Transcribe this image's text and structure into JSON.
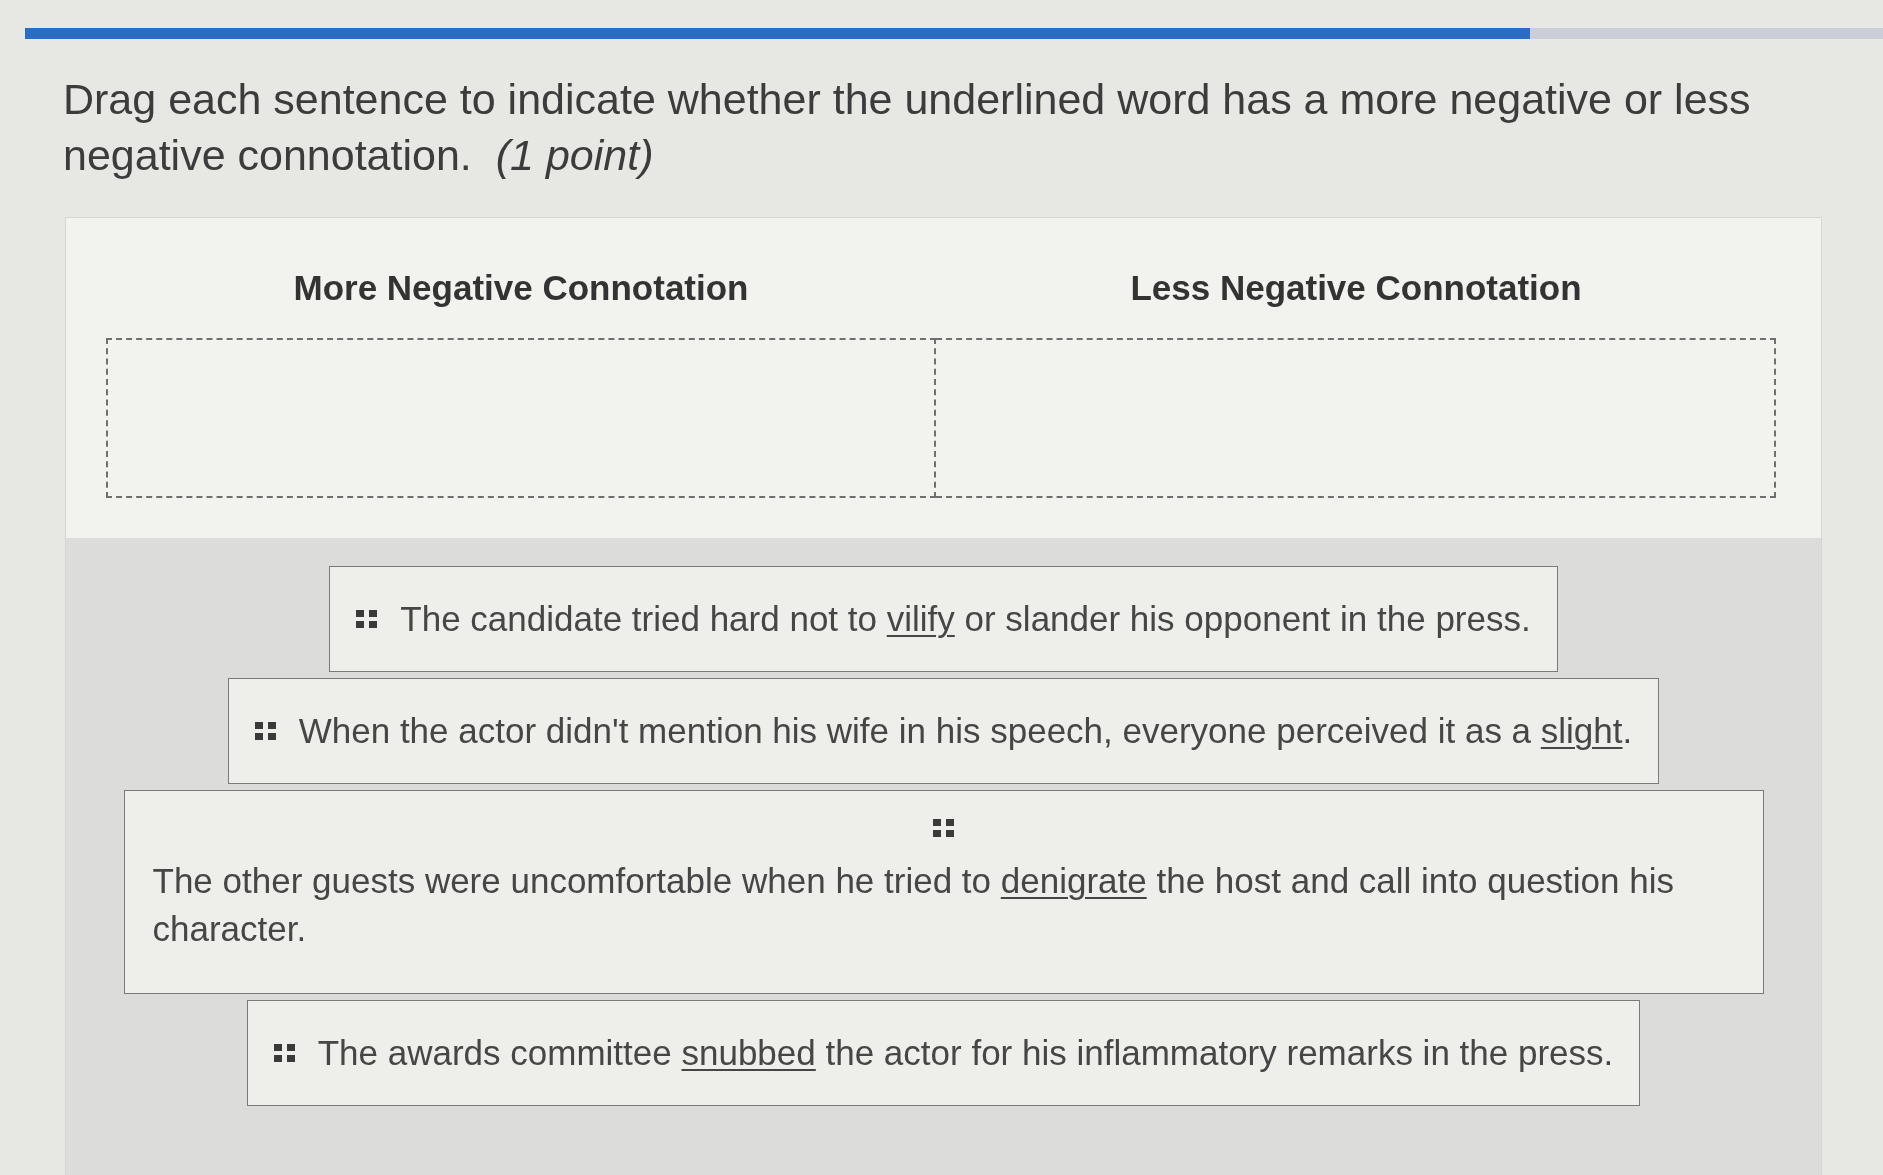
{
  "progress": {
    "level": 0.81
  },
  "question": "Drag each sentence to indicate whether the underlined word has a more negative or less negative connotation.  *(1 point)*",
  "columns": [
    {
      "heading": "More Negative Connotation"
    },
    {
      "heading": "Less Negative Connotation"
    }
  ],
  "sentences": [
    {
      "kind": "inline",
      "before": "The candidate tried hard not to ",
      "underlined": "vilify",
      "after": " or slander his opponent in the press."
    },
    {
      "kind": "inline",
      "before": "When the actor didn't mention his wife in his speech, everyone perceived it as a ",
      "underlined": "slight",
      "after": "."
    },
    {
      "kind": "stacked",
      "before": "The other guests were uncomfortable when he tried to ",
      "underlined": "denigrate",
      "after": " the host and call into question his character."
    },
    {
      "kind": "inline",
      "before": "The awards committee ",
      "underlined": "snubbed",
      "after": " the actor for his inflammatory remarks in the press."
    }
  ]
}
